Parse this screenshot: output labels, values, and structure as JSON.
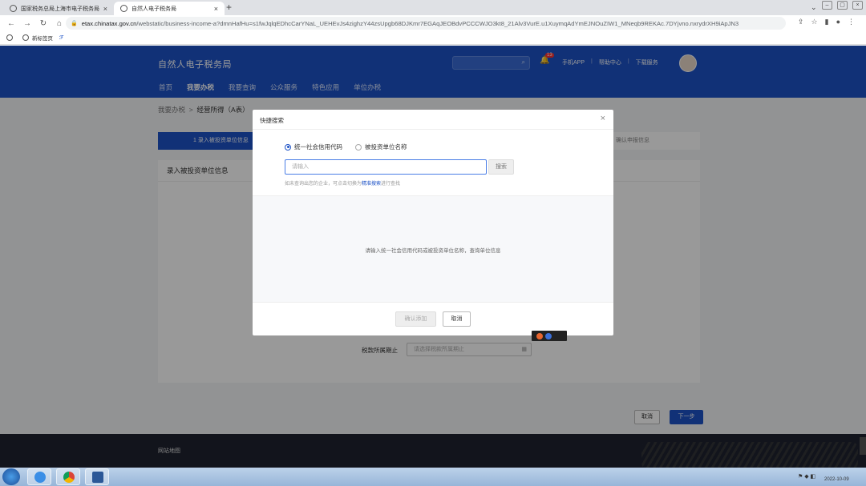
{
  "browser": {
    "tabs": [
      {
        "title": "国家税务总局上海市电子税务局",
        "active": false
      },
      {
        "title": "自然人电子税务局",
        "active": true
      }
    ],
    "url_domain": "etax.chinatax.gov.cn",
    "url_rest": "/webstatic/business-income-a?dmnHafHu=s1fwJqlqEDhcCarYNaL_UEHEvJs4zighzY44zsUpgb68DJKmr7EGAqJEOBdvPCCCWJO3kt8_21Alv3VurE.u1XuymqAdYmEJNOuZIW1_MNeqb9REKAc.7DYjvno.nxrydrXH9iApJN3",
    "bookmarks": [
      "新标签页"
    ]
  },
  "header": {
    "site_title": "自然人电子税务局",
    "notification_count": "13",
    "links": [
      "手机APP",
      "帮助中心",
      "下载服务"
    ],
    "nav": [
      "首页",
      "我要办税",
      "我要查询",
      "公众服务",
      "特色应用",
      "单位办税"
    ],
    "active_nav": "我要办税"
  },
  "page": {
    "breadcrumb_parent": "我要办税",
    "breadcrumb_current": "经营所得（A表）",
    "step1": "1  录入被投资单位信息",
    "step4": "确认申报信息",
    "card_title": "录入被投资单位信息",
    "period_label": "税款所属期止",
    "period_placeholder": "请选择税款所属期止",
    "cancel": "取消",
    "next": "下一步"
  },
  "modal": {
    "title": "快捷搜索",
    "radio_options": [
      "统一社会信用代码",
      "被投资单位名称"
    ],
    "selected_radio": "统一社会信用代码",
    "input_placeholder": "请输入",
    "search_button": "搜索",
    "hint_prefix": "如未查询出您的企业，可点击切换为",
    "hint_link": "精准搜索",
    "hint_suffix": "进行查找",
    "empty_text": "请输入统一社会信用代码或被投资单位名称，查询单位信息",
    "confirm_button": "确认添加",
    "cancel_button": "取消"
  },
  "footer": {
    "link": "网站地图"
  },
  "taskbar": {
    "date": "2022-10-09"
  }
}
